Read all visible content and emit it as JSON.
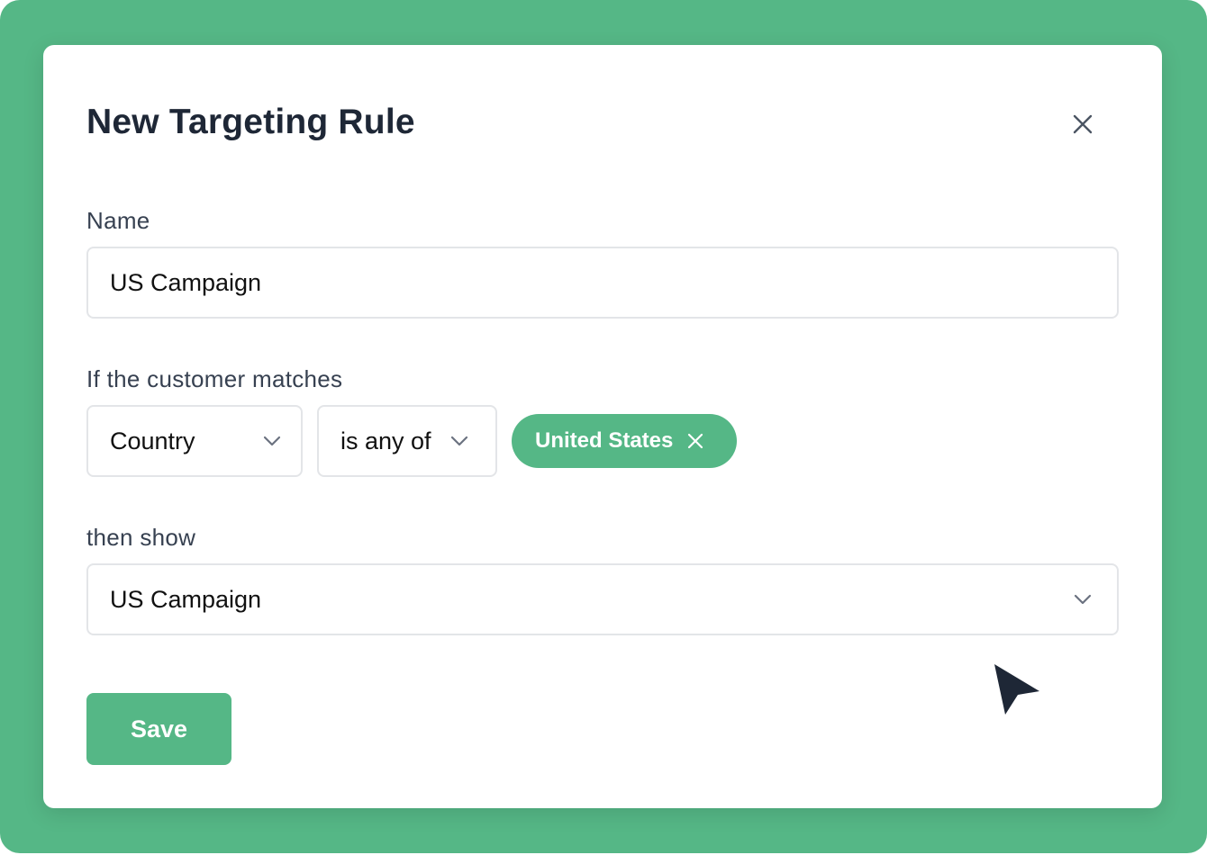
{
  "modal": {
    "title": "New Targeting Rule"
  },
  "name_field": {
    "label": "Name",
    "value": "US Campaign"
  },
  "condition": {
    "label": "If the customer matches",
    "attribute": "Country",
    "operator": "is any of",
    "selected_values": [
      "United States"
    ]
  },
  "then_show": {
    "label": "then show",
    "value": "US Campaign"
  },
  "actions": {
    "save_label": "Save"
  },
  "icons": {
    "close": "close-icon",
    "dropdown": "chevron-down-icon",
    "chip_remove": "x-icon",
    "cursor": "mouse-pointer-icon"
  },
  "colors": {
    "brand_green": "#55b786",
    "title_text": "#1e2736",
    "label_text": "#374151",
    "border": "#e3e5e8"
  }
}
